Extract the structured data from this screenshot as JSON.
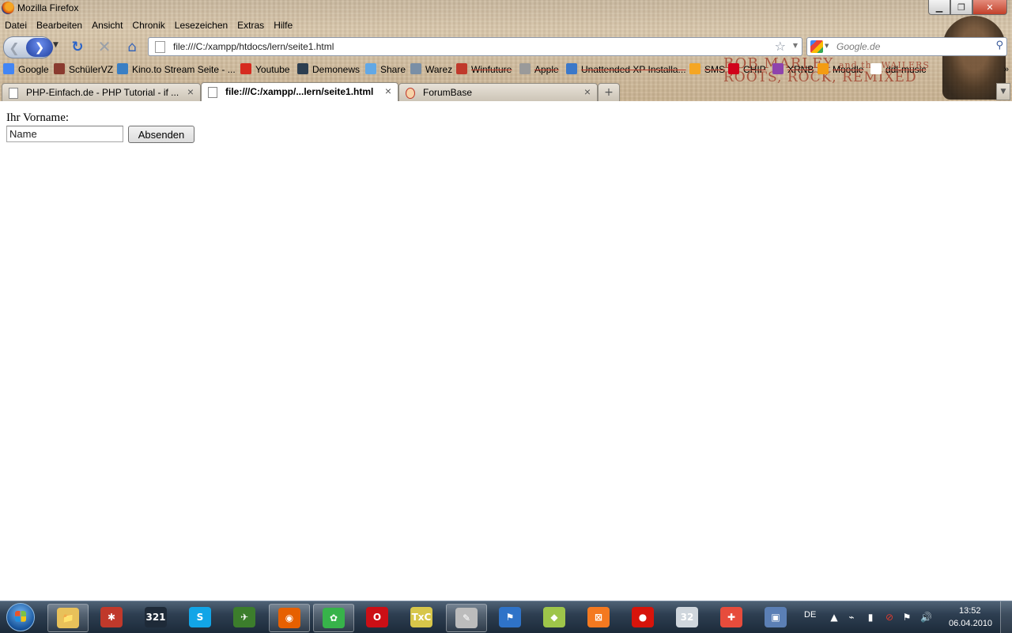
{
  "window": {
    "title": "Mozilla Firefox",
    "min_glyph": "▁",
    "max_glyph": "❐",
    "close_glyph": "✕"
  },
  "menu": [
    "Datei",
    "Bearbeiten",
    "Ansicht",
    "Chronik",
    "Lesezeichen",
    "Extras",
    "Hilfe"
  ],
  "nav": {
    "url": "file:///C:/xampp/htdocs/lern/seite1.html",
    "search_placeholder": "Google.de"
  },
  "bookmarks": [
    {
      "label": "Google",
      "color": "#4285f4",
      "strike": false
    },
    {
      "label": "SchülerVZ",
      "color": "#8a3b2f",
      "strike": false
    },
    {
      "label": "Kino.to Stream Seite - ...",
      "color": "#3a7fc4",
      "strike": false
    },
    {
      "label": "Youtube",
      "color": "#d62b1f",
      "strike": false
    },
    {
      "label": "Demonews",
      "color": "#2c3e50",
      "strike": false
    },
    {
      "label": "Share",
      "color": "#62a8e5",
      "strike": false
    },
    {
      "label": "Warez",
      "color": "#7a8fa6",
      "strike": false
    },
    {
      "label": "Winfuture",
      "color": "#c0392b",
      "strike": true
    },
    {
      "label": "Apple",
      "color": "#9a9a9a",
      "strike": true
    },
    {
      "label": "Unattended XP Installa...",
      "color": "#3b78c9",
      "strike": true
    },
    {
      "label": "SMS",
      "color": "#f5a623",
      "strike": true
    },
    {
      "label": "CHIP",
      "color": "#d0021b",
      "strike": true
    },
    {
      "label": "XRNB",
      "color": "#8e44ad",
      "strike": true
    },
    {
      "label": "Moodle",
      "color": "#f39c12",
      "strike": true
    },
    {
      "label": "ddl-music",
      "color": "#ffffff",
      "strike": true
    }
  ],
  "bookmarks_more": "»",
  "tabs": [
    {
      "label": "PHP-Einfach.de - PHP Tutorial - if ...",
      "active": false
    },
    {
      "label": "file:///C:/xampp/...lern/seite1.html",
      "active": true
    },
    {
      "label": "ForumBase",
      "active": false
    }
  ],
  "theme_text": {
    "line1": "BOB MARLEY",
    "line1b": "and the WAILERS",
    "line2": "ROOTS, ROCK, REMIXED"
  },
  "page": {
    "label": "Ihr Vorname:",
    "input_value": "Name",
    "submit_label": "Absenden"
  },
  "taskbar": {
    "apps": [
      {
        "name": "explorer",
        "glyph": "📁",
        "color": "#e8c15a"
      },
      {
        "name": "app-red-star",
        "glyph": "✱",
        "color": "#c0392b"
      },
      {
        "name": "media-player",
        "glyph": "321",
        "color": "#1e2a38"
      },
      {
        "name": "skype",
        "glyph": "S",
        "color": "#12a5e7"
      },
      {
        "name": "app-green-yellow",
        "glyph": "✈",
        "color": "#3c7d2c"
      },
      {
        "name": "firefox",
        "glyph": "◉",
        "color": "#e66000"
      },
      {
        "name": "icq",
        "glyph": "✿",
        "color": "#37b34a"
      },
      {
        "name": "opera",
        "glyph": "O",
        "color": "#cc0f16"
      },
      {
        "name": "texniccenter",
        "glyph": "TxC",
        "color": "#d7c64a"
      },
      {
        "name": "editor",
        "glyph": "✎",
        "color": "#bcbcbc"
      },
      {
        "name": "app-blue-flag",
        "glyph": "⚑",
        "color": "#2f73c8"
      },
      {
        "name": "app-yellow-green",
        "glyph": "◆",
        "color": "#9ec54a"
      },
      {
        "name": "xampp",
        "glyph": "⊠",
        "color": "#f47920"
      },
      {
        "name": "app-red-apple",
        "glyph": "●",
        "color": "#d7140b"
      },
      {
        "name": "app-box-32",
        "glyph": "32",
        "color": "#cfd6dd"
      },
      {
        "name": "app-multicolor",
        "glyph": "✚",
        "color": "#e74c3c"
      },
      {
        "name": "app-blue-window",
        "glyph": "▣",
        "color": "#5b7fb5"
      }
    ],
    "lang": "DE",
    "time": "13:52",
    "date": "06.04.2010"
  }
}
